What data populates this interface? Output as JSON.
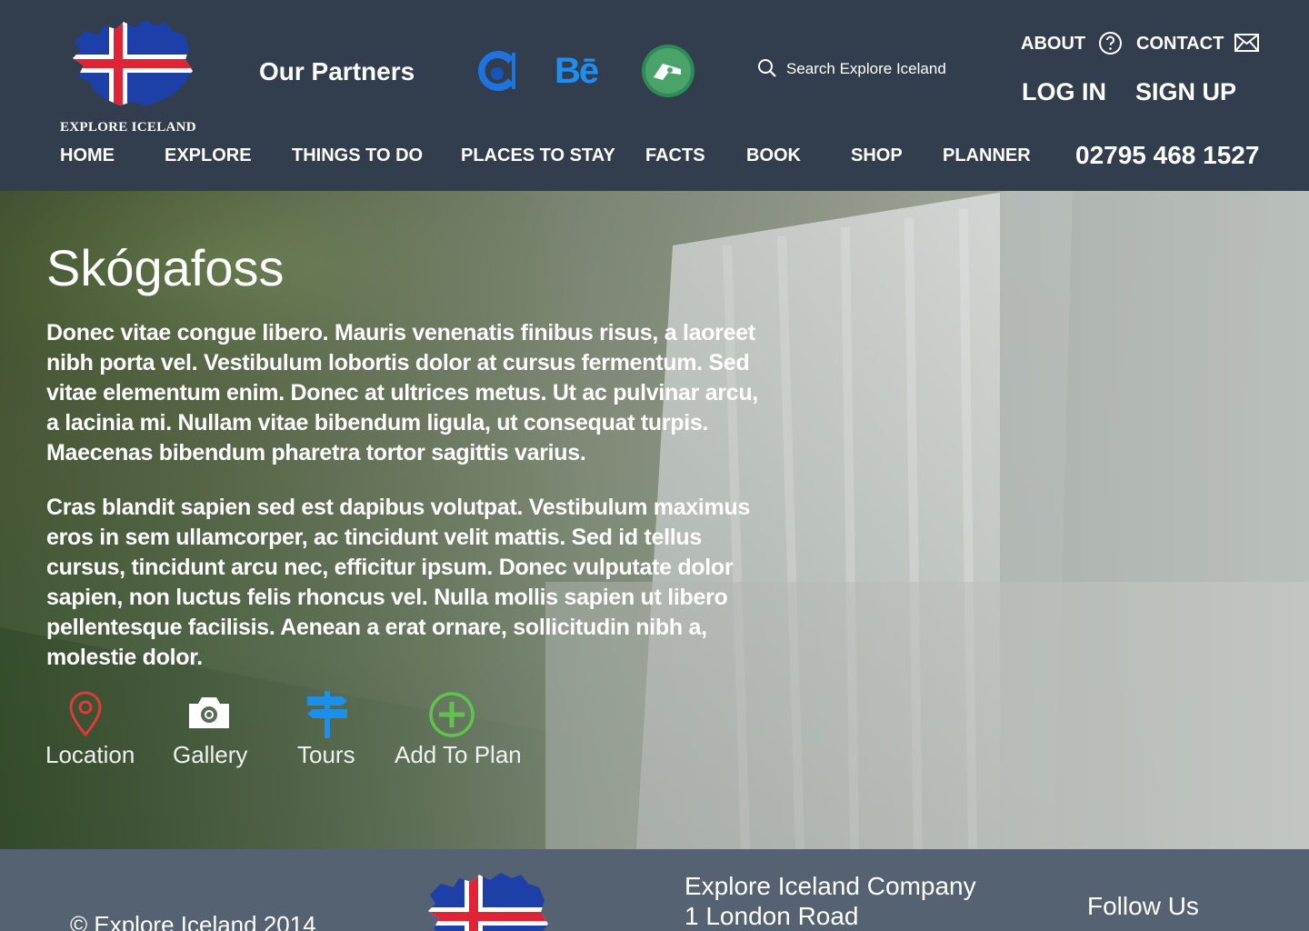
{
  "brand": {
    "name": "EXPLORE ICELAND",
    "flag_colors": {
      "blue": "#1d3fa8",
      "red": "#e02436",
      "white": "#ffffff"
    }
  },
  "header": {
    "partners_title": "Our Partners",
    "partners": [
      {
        "name": "partner-c-icon"
      },
      {
        "name": "behance-icon",
        "text": "Bē"
      },
      {
        "name": "deviantart-icon"
      }
    ],
    "search": {
      "placeholder": "Search Explore Iceland"
    },
    "top_links": {
      "about": "ABOUT",
      "contact": "CONTACT"
    },
    "auth": {
      "login": "LOG IN",
      "signup": "SIGN UP"
    },
    "nav": [
      "HOME",
      "EXPLORE",
      "THINGS TO DO",
      "PLACES TO STAY",
      "FACTS",
      "BOOK",
      "SHOP",
      "PLANNER"
    ],
    "phone": "02795 468 1527"
  },
  "hero": {
    "title": "Skógafoss",
    "paragraphs": [
      "Donec vitae congue libero. Mauris venenatis finibus risus, a laoreet nibh porta vel. Vestibulum lobortis dolor at cursus fermentum. Sed vitae elementum enim. Donec at ultrices metus. Ut ac pulvinar arcu, a lacinia mi. Nullam vitae bibendum ligula, ut consequat turpis. Maecenas bibendum pharetra tortor sagittis varius.",
      "Cras blandit sapien sed est dapibus volutpat. Vestibulum maximus eros in sem ullamcorper, ac tincidunt velit mattis. Sed id tellus cursus, tincidunt arcu nec, efficitur ipsum. Donec vulputate dolor sapien, non luctus felis rhoncus vel. Nulla mollis sapien ut libero pellentesque facilisis. Aenean a erat ornare, sollicitudin nibh a, molestie dolor."
    ],
    "actions": [
      {
        "label": "Location",
        "icon": "location-pin-icon",
        "color": "#e03a3a"
      },
      {
        "label": "Gallery",
        "icon": "camera-icon",
        "color": "#ffffff"
      },
      {
        "label": "Tours",
        "icon": "signpost-icon",
        "color": "#1c8fe8"
      },
      {
        "label": "Add To Plan",
        "icon": "plus-circle-icon",
        "color": "#5fc44a"
      }
    ]
  },
  "footer": {
    "copyright": "© Explore Iceland 2014",
    "company_name": "Explore Iceland Company",
    "address_line": "1 London Road",
    "follow": "Follow Us"
  },
  "colors": {
    "header_bg": "#323e4d",
    "footer_bg": "#546272"
  }
}
